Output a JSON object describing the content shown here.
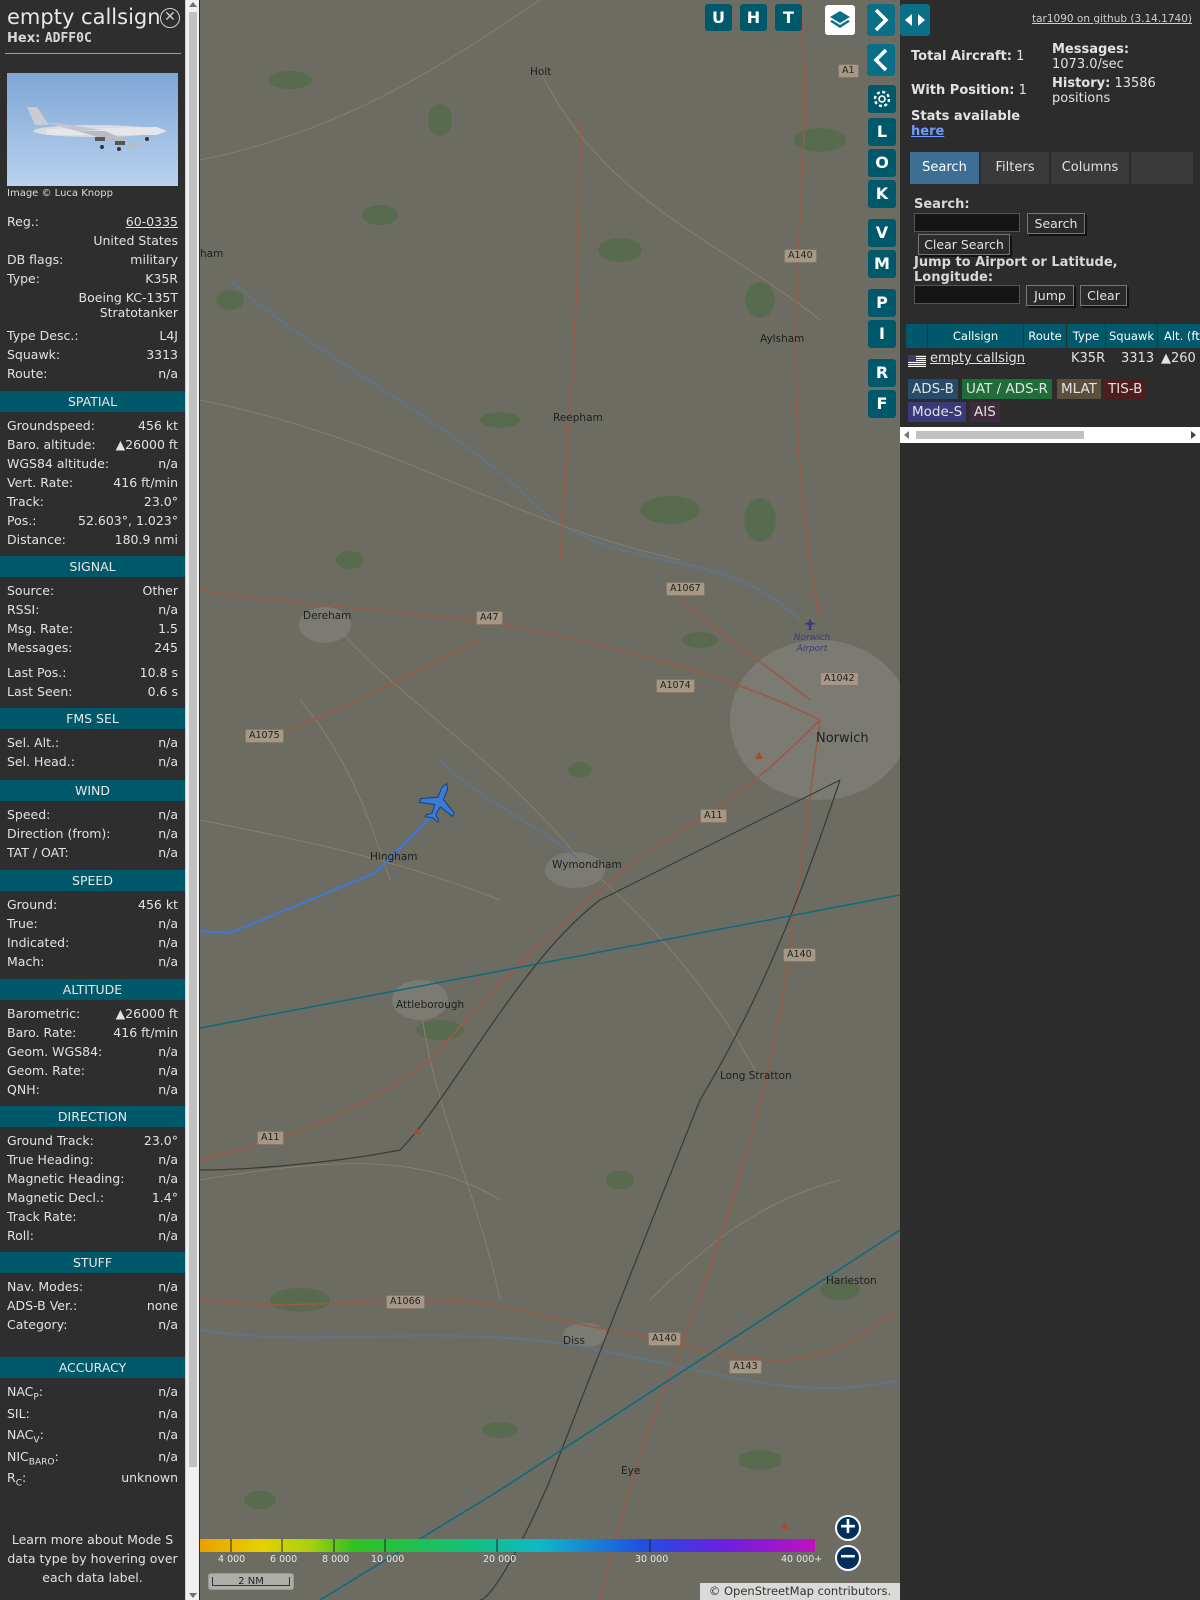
{
  "selected": {
    "callsign": "empty callsign",
    "hex_label": "Hex:",
    "hex": "ADFF0C",
    "photo_credit": "Image © Luca Knopp"
  },
  "details": {
    "reg_label": "Reg.:",
    "reg": "60-0335",
    "country": "United States",
    "dbflags_label": "DB flags:",
    "dbflags": "military",
    "type_label": "Type:",
    "type": "K35R",
    "type_name_1": "Boeing KC-135T",
    "type_name_2": "Stratotanker",
    "typedesc_label": "Type Desc.:",
    "typedesc": "L4J",
    "squawk_label": "Squawk:",
    "squawk": "3313",
    "route_label": "Route:",
    "route": "n/a"
  },
  "sections": {
    "spatial": "SPATIAL",
    "signal": "SIGNAL",
    "fms": "FMS SEL",
    "wind": "WIND",
    "speed": "SPEED",
    "altitude": "ALTITUDE",
    "direction": "DIRECTION",
    "stuff": "STUFF",
    "accuracy": "ACCURACY"
  },
  "spatial": [
    {
      "label": "Groundspeed:",
      "value": "456 kt"
    },
    {
      "label": "Baro. altitude:",
      "value": "▲26000 ft"
    },
    {
      "label": "WGS84 altitude:",
      "value": "n/a"
    },
    {
      "label": "Vert. Rate:",
      "value": "416 ft/min"
    },
    {
      "label": "Track:",
      "value": "23.0°"
    },
    {
      "label": "Pos.:",
      "value": "52.603°, 1.023°"
    },
    {
      "label": "Distance:",
      "value": "180.9 nmi"
    }
  ],
  "signal": [
    {
      "label": "Source:",
      "value": "Other"
    },
    {
      "label": "RSSI:",
      "value": "n/a"
    },
    {
      "label": "Msg. Rate:",
      "value": "1.5"
    },
    {
      "label": "Messages:",
      "value": "245"
    },
    {
      "label": "Last Pos.:",
      "value": "10.8 s"
    },
    {
      "label": "Last Seen:",
      "value": "0.6 s"
    }
  ],
  "fms": [
    {
      "label": "Sel. Alt.:",
      "value": "n/a"
    },
    {
      "label": "Sel. Head.:",
      "value": "n/a"
    }
  ],
  "wind": [
    {
      "label": "Speed:",
      "value": "n/a"
    },
    {
      "label": "Direction (from):",
      "value": "n/a"
    },
    {
      "label": "TAT / OAT:",
      "value": "n/a"
    }
  ],
  "speed": [
    {
      "label": "Ground:",
      "value": "456 kt"
    },
    {
      "label": "True:",
      "value": "n/a"
    },
    {
      "label": "Indicated:",
      "value": "n/a"
    },
    {
      "label": "Mach:",
      "value": "n/a"
    }
  ],
  "altitude": [
    {
      "label": "Barometric:",
      "value": "▲26000 ft"
    },
    {
      "label": "Baro. Rate:",
      "value": "416 ft/min"
    },
    {
      "label": "Geom. WGS84:",
      "value": "n/a"
    },
    {
      "label": "Geom. Rate:",
      "value": "n/a"
    },
    {
      "label": "QNH:",
      "value": "n/a"
    }
  ],
  "direction": [
    {
      "label": "Ground Track:",
      "value": "23.0°"
    },
    {
      "label": "True Heading:",
      "value": "n/a"
    },
    {
      "label": "Magnetic Heading:",
      "value": "n/a"
    },
    {
      "label": "Magnetic Decl.:",
      "value": "1.4°"
    },
    {
      "label": "Track Rate:",
      "value": "n/a"
    },
    {
      "label": "Roll:",
      "value": "n/a"
    }
  ],
  "stuff": [
    {
      "label": "Nav. Modes:",
      "value": "n/a"
    },
    {
      "label": "ADS-B Ver.:",
      "value": "none"
    },
    {
      "label": "Category:",
      "value": "n/a"
    }
  ],
  "accuracy": [
    {
      "label": "NAC",
      "sub": "P",
      "value": "n/a"
    },
    {
      "label": "SIL:",
      "sub": "",
      "value": "n/a"
    },
    {
      "label": "NAC",
      "sub": "V",
      "value": "n/a"
    },
    {
      "label": "NIC",
      "sub": "BARO",
      "value": "n/a"
    },
    {
      "label": "R",
      "sub": "C",
      "value": "unknown"
    }
  ],
  "footnote": [
    "Learn more about Mode S",
    "data type by hovering over",
    "each data label."
  ],
  "map": {
    "places": [
      "Holt",
      "Aylsham",
      "Reepham",
      "Dereham",
      "Norwich Airport",
      "Norwich",
      "Hingham",
      "Wymondham",
      "Attleborough",
      "Long Stratton",
      "Harleston",
      "Diss",
      "Eye",
      "ham"
    ],
    "roads": [
      "A140",
      "A1067",
      "A47",
      "A1074",
      "A1042",
      "A1075",
      "A11",
      "A140",
      "A11",
      "A1066",
      "A140",
      "A143",
      "A1"
    ],
    "toolbar": [
      "U",
      "H",
      "T"
    ],
    "side_buttons": [
      "L",
      "O",
      "K",
      "V",
      "M",
      "P",
      "I",
      "R",
      "F"
    ],
    "alt_ticks": [
      "4 000",
      "6 000",
      "8 000",
      "10 000",
      "20 000",
      "30 000",
      "40 000+"
    ],
    "scale": "2 NM",
    "attribution": "© OpenStreetMap contributors.",
    "zoom_in": "+",
    "zoom_out": "−"
  },
  "panel": {
    "github": "tar1090 on github (3.14.1740)",
    "total_label": "Total Aircraft:",
    "total": "1",
    "withpos_label": "With Position:",
    "withpos": "1",
    "stats_label": "Stats available",
    "stats_link": "here",
    "messages_label": "Messages:",
    "messages": "1073.0/sec",
    "history_label": "History:",
    "history": "13586",
    "history_unit": "positions",
    "tabs": [
      "Search",
      "Filters",
      "Columns"
    ],
    "search_label": "Search:",
    "search_btn": "Search",
    "clear_search_btn": "Clear Search",
    "jump_label": "Jump to Airport or Latitude, Longitude:",
    "jump_btn": "Jump",
    "clear_btn": "Clear",
    "columns": [
      "Callsign",
      "Route",
      "Type",
      "Squawk",
      "Alt. (ft)"
    ],
    "row": {
      "callsign": "empty callsign",
      "route": "",
      "type": "K35R",
      "squawk": "3313",
      "alt": "▲260"
    },
    "legend": [
      "ADS-B",
      "UAT / ADS-R",
      "MLAT",
      "TIS-B",
      "Mode-S",
      "AIS"
    ],
    "legend_colors": [
      "#284b6b",
      "#1f6e3a",
      "#5c4f3e",
      "#4f1d1d",
      "#3a3a7a",
      "#3e2c3e"
    ]
  }
}
